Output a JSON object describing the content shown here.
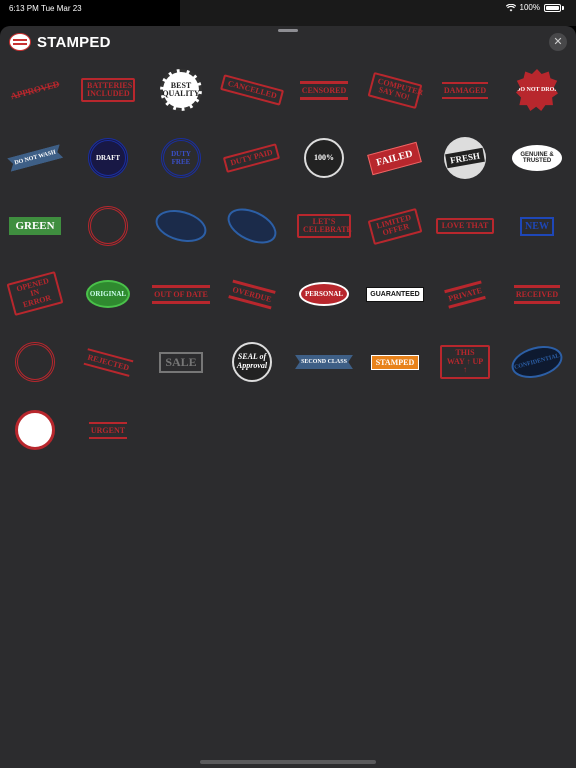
{
  "status_bar": {
    "time": "6:13 PM",
    "date": "Tue Mar 23",
    "battery": "100%"
  },
  "header": {
    "title": "STAMPED",
    "close": "✕"
  },
  "stickers": [
    "APPROVED",
    "BATTERIES INCLUDED",
    "BEST QUALITY",
    "CANCELLED",
    "CENSORED",
    "COMPUTER SAY NO!",
    "DAMAGED",
    "DO NOT DROP",
    "DO NOT WASH",
    "DRAFT",
    "DUTY FREE",
    "DUTY PAID",
    "100%",
    "FAILED",
    "FRESH",
    "GENUINE & TRUSTED",
    "GREEN",
    "",
    "",
    "",
    "LET'S CELEBRATE",
    "LIMITED OFFER",
    "LOVE THAT",
    "NEW",
    "OPENED IN ERROR",
    "ORIGINAL",
    "OUT OF DATE",
    "OVERDUE",
    "PERSONAL",
    "GUARANTEED",
    "PRIVATE",
    "RECEIVED",
    "",
    "REJECTED",
    "SALE",
    "SEAL of Approval",
    "SECOND CLASS",
    "STAMPED",
    "THIS WAY ↑ UP ↑",
    "CONFIDENTIAL",
    "",
    "URGENT"
  ]
}
